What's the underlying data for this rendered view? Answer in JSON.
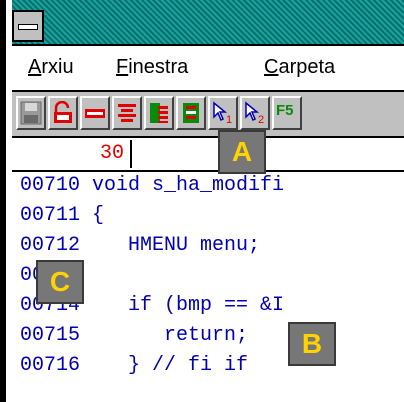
{
  "menu": {
    "items": [
      {
        "label": "Arxiu",
        "underline": "A"
      },
      {
        "label": "Finestra",
        "underline": "F"
      },
      {
        "label": "Carpeta",
        "underline": "C"
      }
    ]
  },
  "toolbar": {
    "buttons": [
      {
        "icon": "save-icon"
      },
      {
        "icon": "unlock-icon"
      },
      {
        "icon": "line-icon"
      },
      {
        "icon": "align-icon"
      },
      {
        "icon": "folder-stack-icon"
      },
      {
        "icon": "green-stack-icon"
      },
      {
        "icon": "cursor-1-icon"
      },
      {
        "icon": "cursor-2-icon"
      },
      {
        "icon": "f5-icon",
        "label": "F5"
      }
    ]
  },
  "line_field": {
    "value": "30"
  },
  "code": {
    "lines": [
      "00710 void s_ha_modifi",
      "00711 {",
      "00712    HMENU menu;",
      "00713",
      "00714    if (bmp == &I",
      "00715       return;",
      "00716    } // fi if"
    ]
  },
  "badges": {
    "a": "A",
    "b": "B",
    "c": "C"
  },
  "colors": {
    "title_bar": "#0a7a78",
    "code_text": "#0000b0",
    "line_number": "#e00000",
    "badge_text": "#ffd200",
    "badge_bg": "#777777"
  }
}
